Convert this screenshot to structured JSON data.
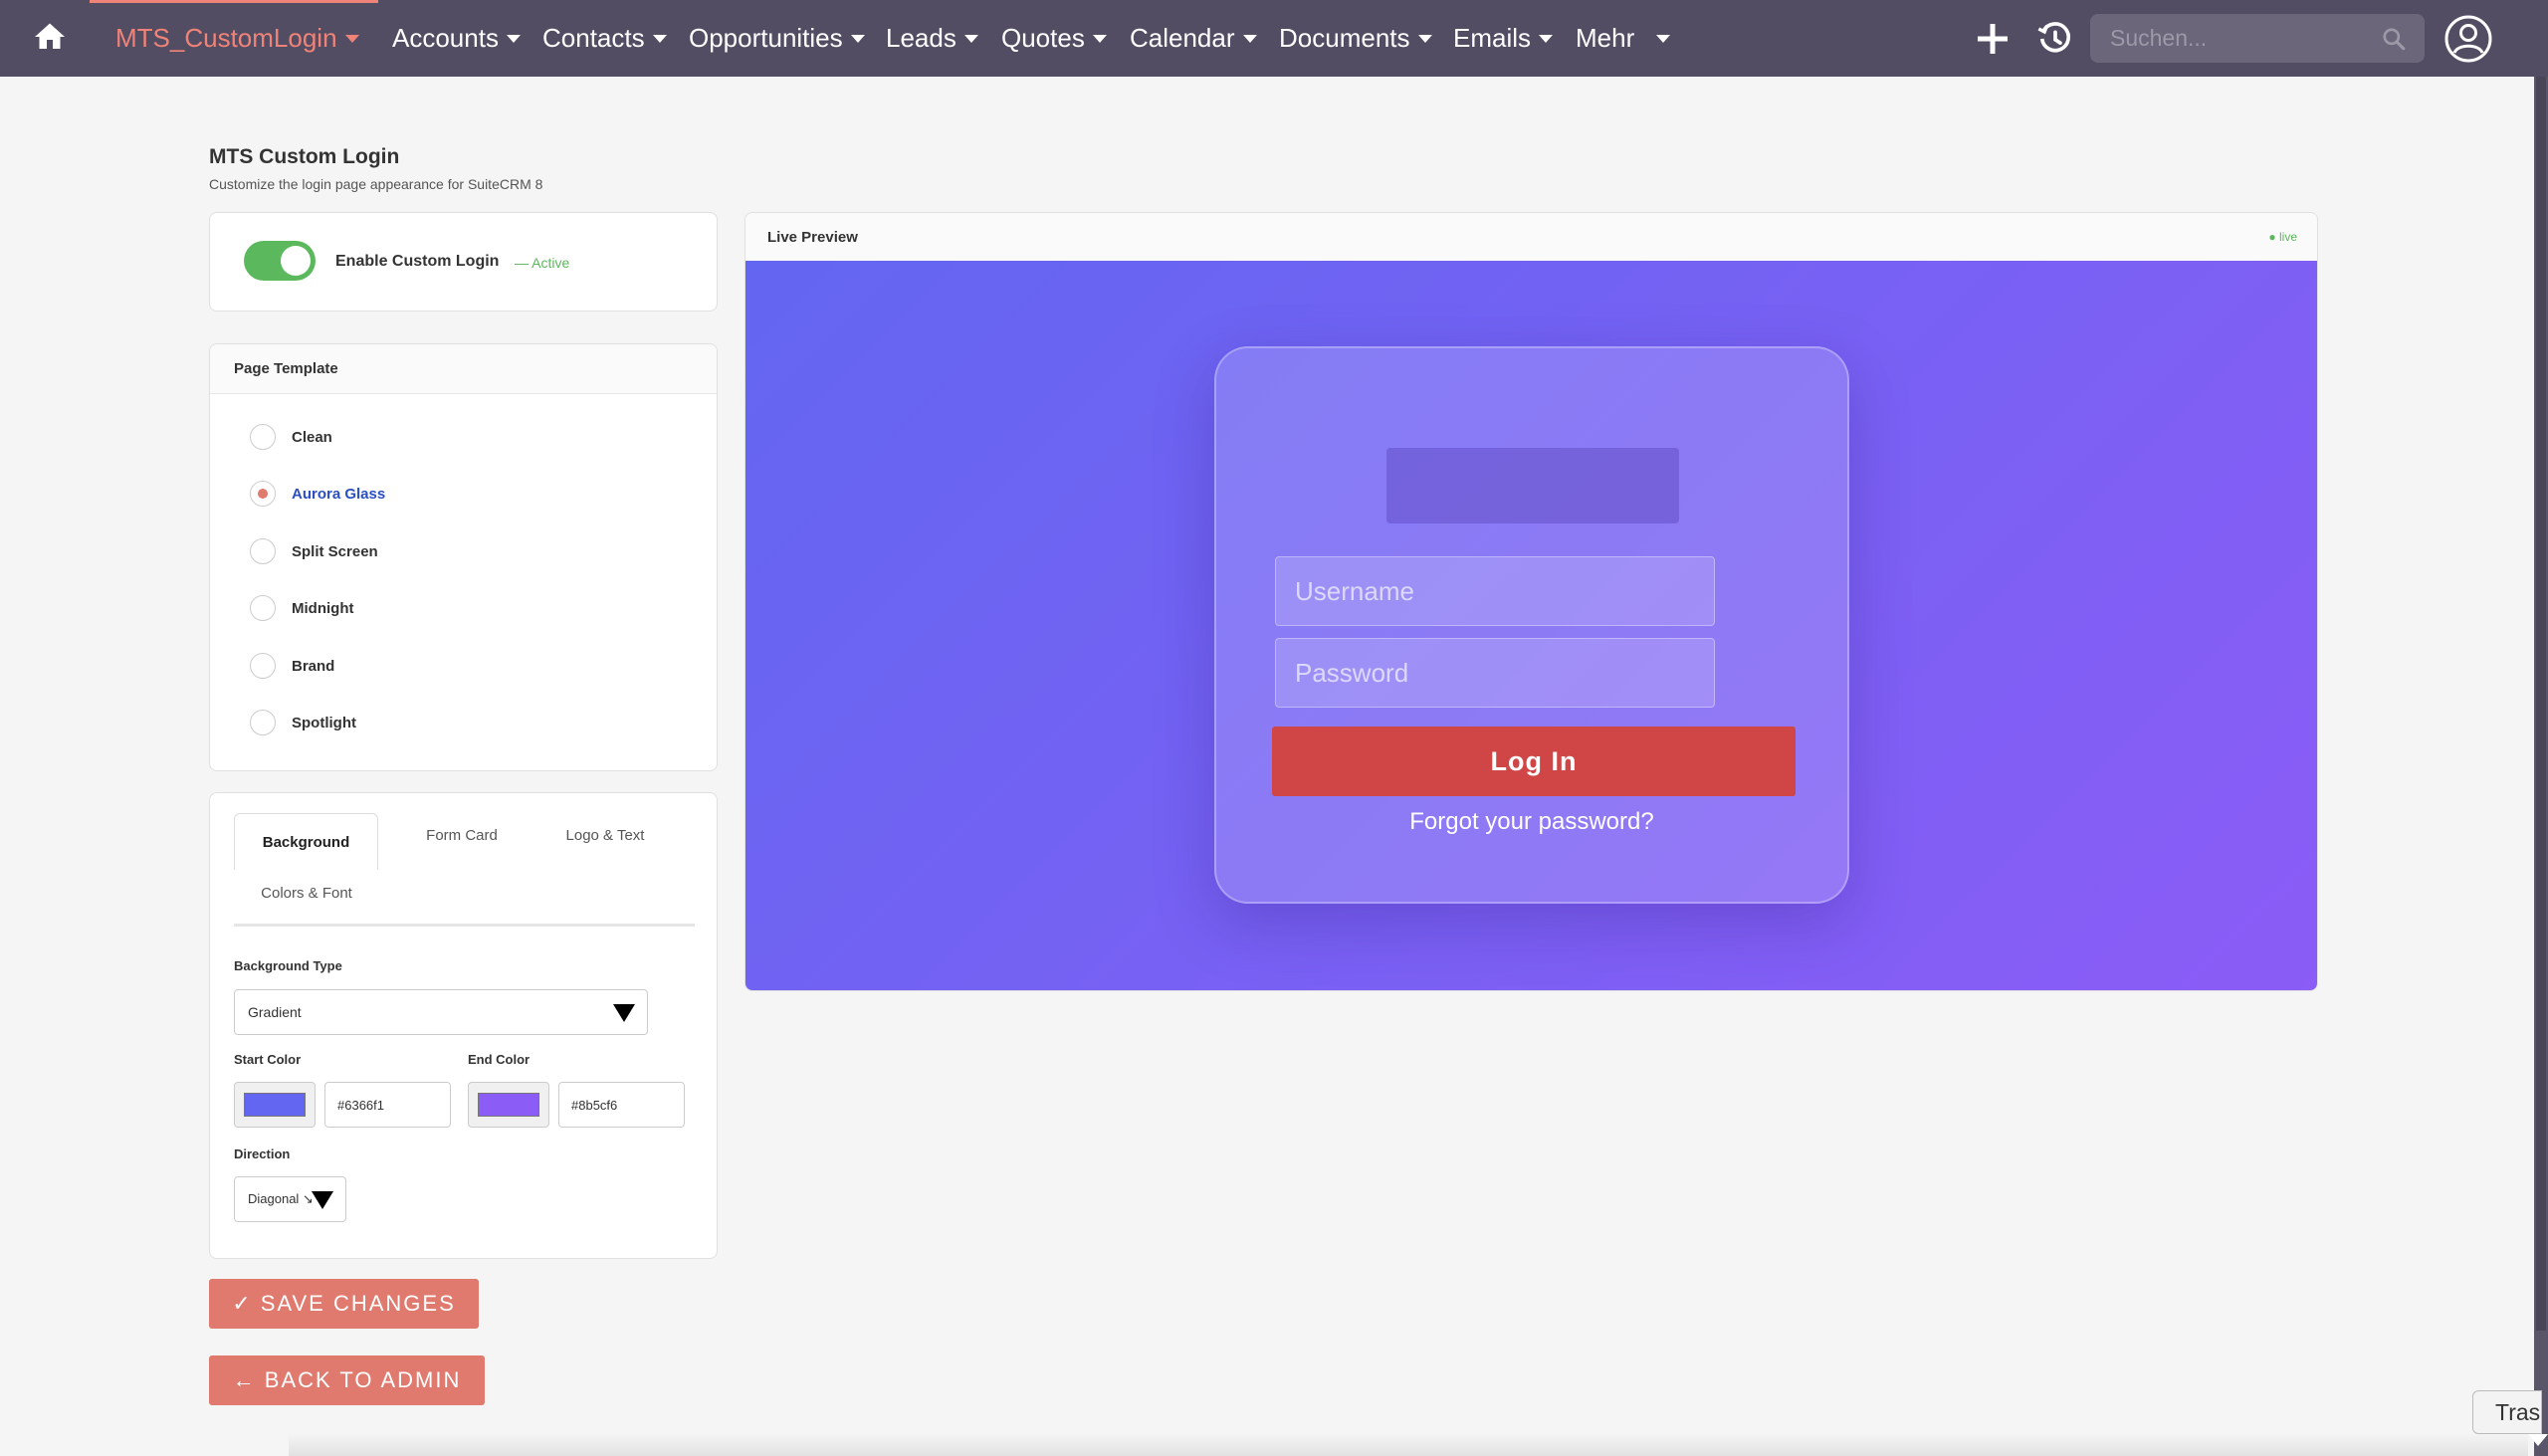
{
  "nav": {
    "active_module": "MTS_CustomLogin",
    "items": [
      "Accounts",
      "Contacts",
      "Opportunities",
      "Leads",
      "Quotes",
      "Calendar",
      "Documents",
      "Emails",
      "Mehr"
    ],
    "search_placeholder": "Suchen..."
  },
  "page": {
    "title": "MTS Custom Login",
    "subtitle": "Customize the login page appearance for SuiteCRM 8"
  },
  "toggle": {
    "label": "Enable Custom Login",
    "status": "— Active",
    "enabled": true
  },
  "templates": {
    "heading": "Page Template",
    "options": [
      "Clean",
      "Aurora Glass",
      "Split Screen",
      "Midnight",
      "Brand",
      "Spotlight"
    ],
    "selected": "Aurora Glass"
  },
  "settings": {
    "tabs": [
      "Background",
      "Form Card",
      "Logo & Text",
      "Colors & Font"
    ],
    "active_tab": "Background",
    "background_type_label": "Background Type",
    "background_type_value": "Gradient",
    "start_color_label": "Start Color",
    "start_color_value": "#6366f1",
    "end_color_label": "End Color",
    "end_color_value": "#8b5cf6",
    "direction_label": "Direction",
    "direction_value": "Diagonal ↘"
  },
  "buttons": {
    "save": "✓ SAVE CHANGES",
    "back": "← BACK TO ADMIN"
  },
  "preview": {
    "title": "Live Preview",
    "live_badge": "● live",
    "username_placeholder": "Username",
    "password_placeholder": "Password",
    "login_label": "Log In",
    "forgot_label": "Forgot your password?"
  },
  "trash": {
    "label": "Trash"
  },
  "colors": {
    "nav_bg": "#534d64",
    "accent": "#f08377",
    "button": "#e07a6e",
    "login_button": "#d04545",
    "success": "#5cb85c"
  }
}
